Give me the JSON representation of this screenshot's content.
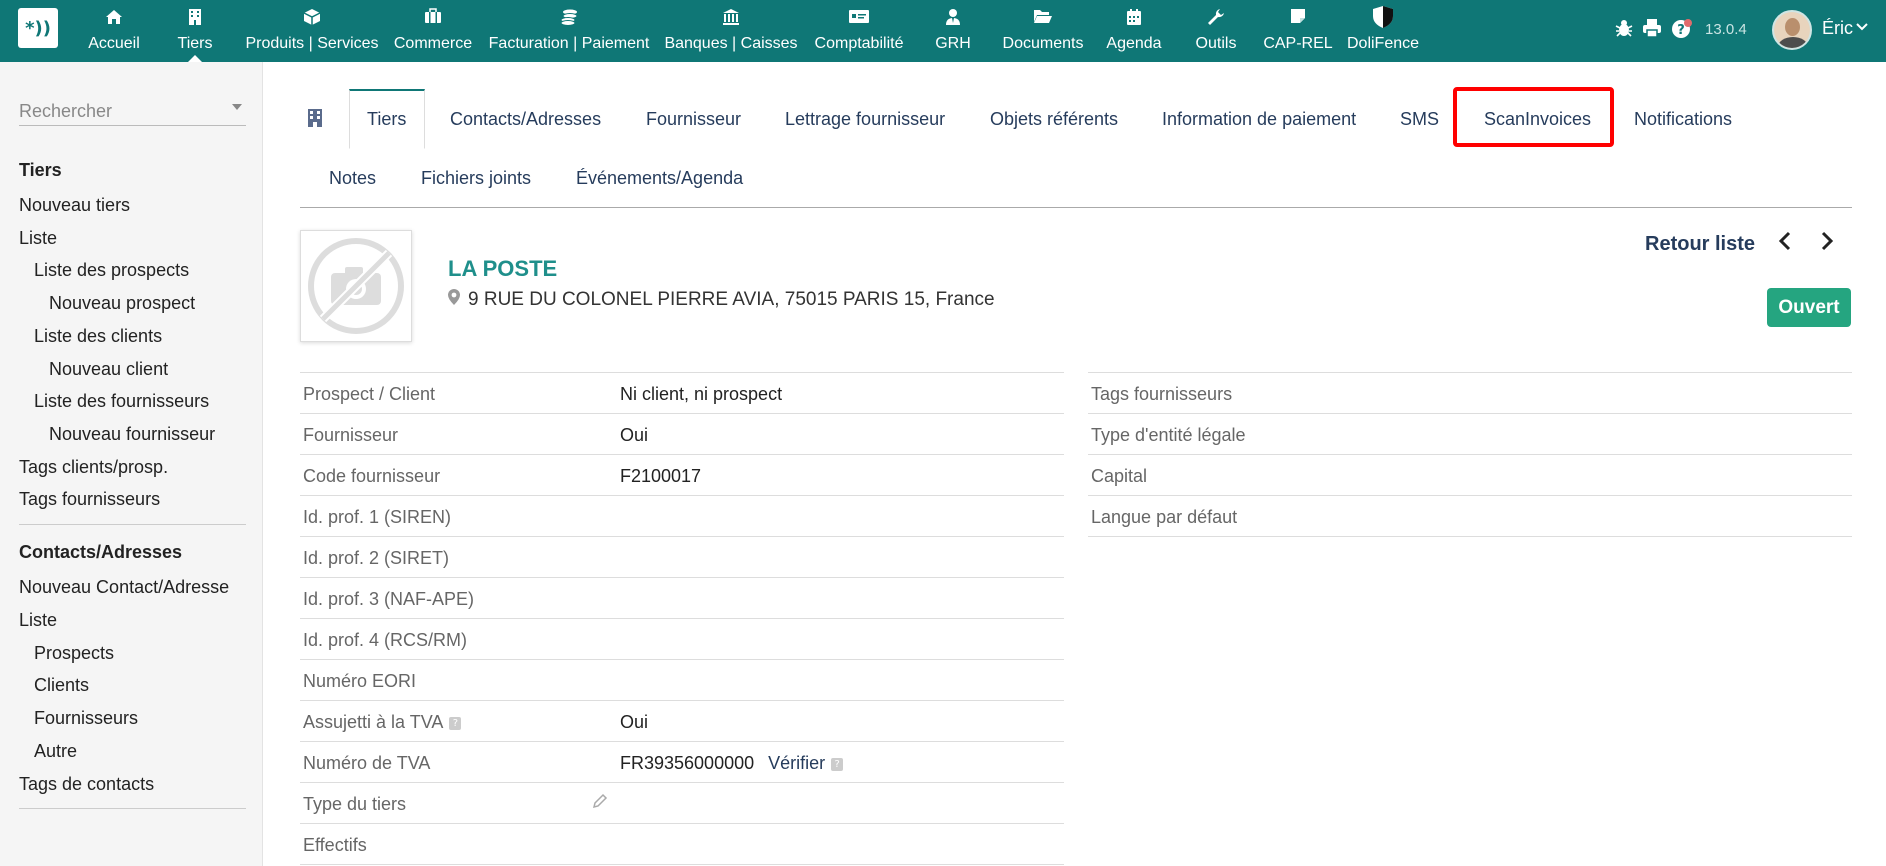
{
  "topbar": {
    "logo_text": "*))",
    "menu": [
      {
        "label": "Accueil",
        "icon": "home-icon",
        "glyph": "⌂"
      },
      {
        "label": "Tiers",
        "icon": "building-icon",
        "glyph": "▦"
      },
      {
        "label": "Produits | Services",
        "icon": "cube-icon",
        "glyph": "◆"
      },
      {
        "label": "Commerce",
        "icon": "briefcase-icon",
        "glyph": "▣"
      },
      {
        "label": "Facturation | Paiement",
        "icon": "coins-icon",
        "glyph": "≋"
      },
      {
        "label": "Banques | Caisses",
        "icon": "bank-icon",
        "glyph": "⌂"
      },
      {
        "label": "Comptabilité",
        "icon": "money-check-icon",
        "glyph": "▭"
      },
      {
        "label": "GRH",
        "icon": "user-tie-icon",
        "glyph": "♟"
      },
      {
        "label": "Documents",
        "icon": "folder-open-icon",
        "glyph": "▰"
      },
      {
        "label": "Agenda",
        "icon": "calendar-icon",
        "glyph": "▦"
      },
      {
        "label": "Outils",
        "icon": "wrench-icon",
        "glyph": "✎"
      },
      {
        "label": "CAP-REL",
        "icon": "sticky-note-icon",
        "glyph": "▰"
      },
      {
        "label": "DoliFence",
        "icon": "shield-icon",
        "glyph": "◗"
      }
    ],
    "version": "13.0.4",
    "user_name": "Éric",
    "icons": {
      "bug": "bug-icon",
      "print": "print-icon",
      "help": "help-icon"
    }
  },
  "sidebar": {
    "search_placeholder": "Rechercher",
    "section1": {
      "title": "Tiers",
      "items": [
        "Nouveau tiers",
        "Liste",
        "Liste des prospects",
        "Nouveau prospect",
        "Liste des clients",
        "Nouveau client",
        "Liste des fournisseurs",
        "Nouveau fournisseur",
        "Tags clients/prosp.",
        "Tags fournisseurs"
      ]
    },
    "section2": {
      "title": "Contacts/Adresses",
      "items": [
        "Nouveau Contact/Adresse",
        "Liste",
        "Prospects",
        "Clients",
        "Fournisseurs",
        "Autre",
        "Tags de contacts"
      ]
    }
  },
  "tabs": {
    "row1": [
      "Tiers",
      "Contacts/Adresses",
      "Fournisseur",
      "Lettrage fournisseur",
      "Objets référents",
      "Information de paiement",
      "SMS",
      "ScanInvoices",
      "Notifications"
    ],
    "row2": [
      "Notes",
      "Fichiers joints",
      "Événements/Agenda"
    ],
    "active": "Tiers"
  },
  "company": {
    "name": "LA POSTE",
    "address": "9 RUE DU COLONEL PIERRE AVIA, 75015 PARIS 15, France",
    "back_list": "Retour liste",
    "status": "Ouvert",
    "status_color": "#25a580"
  },
  "fields_left": [
    {
      "label": "Prospect / Client",
      "value": "Ni client, ni prospect"
    },
    {
      "label": "Fournisseur",
      "value": "Oui"
    },
    {
      "label": "Code fournisseur",
      "value": "F2100017"
    },
    {
      "label": "Id. prof. 1 (SIREN)",
      "value": ""
    },
    {
      "label": "Id. prof. 2 (SIRET)",
      "value": ""
    },
    {
      "label": "Id. prof. 3 (NAF-APE)",
      "value": ""
    },
    {
      "label": "Id. prof. 4 (RCS/RM)",
      "value": ""
    },
    {
      "label": "Numéro EORI",
      "value": ""
    },
    {
      "label": "Assujetti à la TVA",
      "value": "Oui"
    },
    {
      "label": "Numéro de TVA",
      "value": "FR39356000000",
      "link": "Vérifier"
    },
    {
      "label": "Type du tiers",
      "value": ""
    },
    {
      "label": "Effectifs",
      "value": ""
    }
  ],
  "fields_right": [
    {
      "label": "Tags fournisseurs",
      "value": ""
    },
    {
      "label": "Type d'entité légale",
      "value": ""
    },
    {
      "label": "Capital",
      "value": ""
    },
    {
      "label": "Langue par défaut",
      "value": ""
    }
  ],
  "colors": {
    "topbar": "#0f7776",
    "link": "#263c5c",
    "company_name": "#1f8f8b",
    "highlight": "#ff0000"
  }
}
